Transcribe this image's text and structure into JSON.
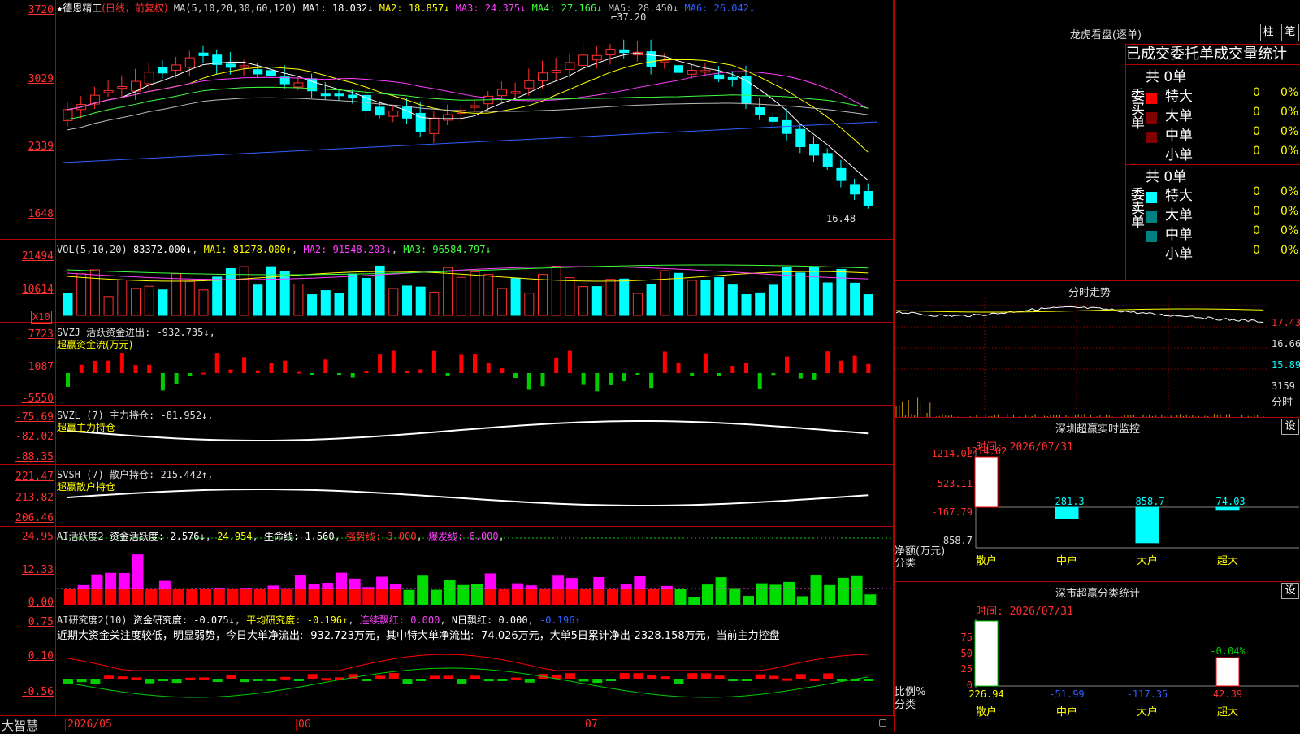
{
  "kline": {
    "star": "★",
    "stock_name": "德恩精工",
    "period": "(日线，前复权)",
    "ma_label": "MA(5,10,20,30,60,120)",
    "ma": [
      {
        "label": "MA1: 18.032↓",
        "color": "#ffffff"
      },
      {
        "label": "MA2: 18.857↓",
        "color": "#ffff00"
      },
      {
        "label": "MA3: 24.375↓",
        "color": "#ff40ff"
      },
      {
        "label": "MA4: 27.166↓",
        "color": "#40ff40"
      },
      {
        "label": "MA5: 28.450↓",
        "color": "#bbbbbb"
      },
      {
        "label": "MA6: 26.042↓",
        "color": "#3060ff"
      }
    ],
    "y_ticks": [
      "3720",
      "3029",
      "2339",
      "1648"
    ],
    "high_mark": "37.20",
    "low_mark": "16.48"
  },
  "vol": {
    "label": "VOL(5,10,20)",
    "value": "83372.000↓",
    "ma1": "MA1: 81278.000↑",
    "ma2": "MA2: 91548.203↓",
    "ma3": "MA3: 96584.797↓",
    "y_ticks": [
      "21494",
      "10614"
    ],
    "unit": "X10"
  },
  "svzj": {
    "label": "SVZJ  活跃资金进出: -932.735↓,",
    "sub": "超赢资金流(万元)",
    "y_ticks": [
      "7723",
      "1087",
      "-5550"
    ]
  },
  "svzl": {
    "label": "SVZL (7) 主力持仓: -81.952↓,",
    "sub": "超赢主力持仓",
    "y_ticks": [
      "-75.69",
      "-82.02",
      "-88.35"
    ]
  },
  "svsh": {
    "label": "SVSH (7) 散户持仓: 215.442↑,",
    "sub": "超赢散户持仓",
    "y_ticks": [
      "221.47",
      "213.82",
      "206.46"
    ]
  },
  "ai_active": {
    "label": "AI活跃度2",
    "items": [
      {
        "text": "资金活跃度: 2.576↓",
        "color": "#ffffff"
      },
      {
        "text": "24.954",
        "color": "#ffff00"
      },
      {
        "text": "生命线: 1.560",
        "color": "#ffffff"
      },
      {
        "text": "强势线: 3.000",
        "color": "#ff3030"
      },
      {
        "text": "爆发线: 6.000",
        "color": "#ff40ff"
      }
    ],
    "y_ticks": [
      "24.95",
      "12.33",
      "0.00"
    ]
  },
  "ai_research": {
    "label": "AI研究度2(10)",
    "items": [
      {
        "text": "资金研究度: -0.075↓",
        "color": "#ffffff"
      },
      {
        "text": "平均研究度: -0.196↑",
        "color": "#ffff00"
      },
      {
        "text": "连续飘红: 0.000",
        "color": "#ff40ff"
      },
      {
        "text": "N日飘红: 0.000",
        "color": "#ffffff"
      },
      {
        "text": "-0.196↑",
        "color": "#3060ff"
      }
    ],
    "comment": "近期大资金关注度较低，明显弱势，今日大单净流出: -932.723万元，其中特大单净流出: -74.026万元，大单5日累计净出-2328.158万元，当前主力控盘",
    "y_ticks": [
      "0.75",
      "0.10",
      "-0.56"
    ]
  },
  "xaxis": {
    "brand": "大智慧",
    "labels": [
      "2026/05",
      "06",
      "07"
    ]
  },
  "dragon": {
    "title": "龙虎看盘(逐单)",
    "btn_zhu": "柱",
    "btn_bi": "笔",
    "header": "已成交委托单成交量统计",
    "buy_side": "委买单",
    "sell_side": "委卖单",
    "buy_total": "共 0单",
    "sell_total": "共 0单",
    "rows": [
      {
        "name": "特大",
        "val": "0",
        "pct": "0%"
      },
      {
        "name": "大单",
        "val": "0",
        "pct": "0%"
      },
      {
        "name": "中单",
        "val": "0",
        "pct": "0%"
      },
      {
        "name": "小单",
        "val": "0",
        "pct": "0%"
      }
    ],
    "buy_colors": [
      "#ff0000",
      "#800000",
      "#800000"
    ],
    "sell_colors": [
      "#00ffff",
      "#008080",
      "#008080"
    ]
  },
  "fenshi": {
    "title": "分时走势",
    "y_ticks": [
      "17.43",
      "16.66",
      "15.89"
    ],
    "vol_label": "3159",
    "vol_caption": "分时"
  },
  "monitor": {
    "title": "深圳超赢实时监控",
    "btn": "设",
    "time": "时间: 2026/07/31",
    "y_ticks": [
      "1214.02",
      "523.11",
      "-167.79",
      "-858.7"
    ],
    "y_caption": "净额(万元)",
    "x_caption": "分类",
    "categories": [
      "散户",
      "中户",
      "大户",
      "超大"
    ],
    "values": [
      1214.02,
      -281.3,
      -858.7,
      -74.03
    ],
    "value_labels": [
      "1214.02",
      "-281.3",
      "-858.7",
      "-74.03"
    ]
  },
  "classify": {
    "title": "深市超赢分类统计",
    "btn": "设",
    "time": "时间: 2026/07/31",
    "y_ticks": [
      "75",
      "50",
      "25",
      "0"
    ],
    "y_caption": "比例%",
    "x_caption": "分类",
    "categories": [
      "散户",
      "中户",
      "大户",
      "超大"
    ],
    "values": [
      "226.94",
      "-51.99",
      "-117.35",
      "42.39"
    ],
    "extra_label": "-0.04%"
  }
}
